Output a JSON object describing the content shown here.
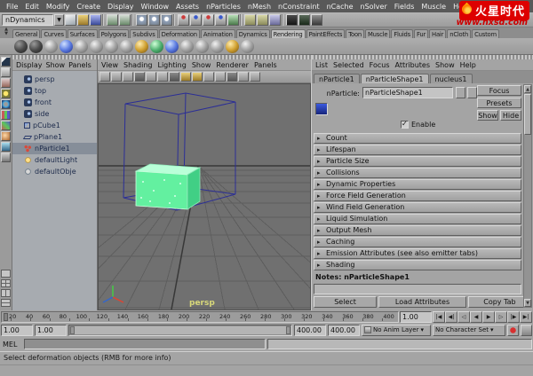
{
  "colors": {
    "viewport_bg": "#707070",
    "particle_green": "#63f0a0",
    "wireframe_blue": "#2b2e96",
    "watermark_red": "#dd0000",
    "selection_highlight": "#868e99"
  },
  "watermark": {
    "brand": "火星时代",
    "url": "www.hxsd.com"
  },
  "menubar": {
    "items": [
      "File",
      "Edit",
      "Modify",
      "Create",
      "Display",
      "Window",
      "Assets",
      "nParticles",
      "nMesh",
      "nConstraint",
      "nCache",
      "nSolver",
      "Fields",
      "Muscle",
      "Help"
    ]
  },
  "statusline": {
    "menuset": "nDynamics",
    "icons": [
      {
        "name": "new-scene-icon",
        "cls": "ic-doc"
      },
      {
        "name": "open-scene-icon",
        "cls": "ic-folder"
      },
      {
        "name": "save-scene-icon",
        "cls": "ic-save"
      },
      {
        "name": "group-separator",
        "cls": "sep"
      },
      {
        "name": "undo-icon",
        "cls": "ic-undo"
      },
      {
        "name": "redo-icon",
        "cls": "ic-redo"
      },
      {
        "name": "group-separator",
        "cls": "sep"
      },
      {
        "name": "select-hierarchy-icon",
        "cls": "ic-sel"
      },
      {
        "name": "select-object-icon",
        "cls": "ic-sel2"
      },
      {
        "name": "select-component-icon",
        "cls": "ic-sel3"
      },
      {
        "name": "group-separator",
        "cls": "sep"
      },
      {
        "name": "snap-to-grid-icon",
        "cls": "ic-snap"
      },
      {
        "name": "snap-to-curve-icon",
        "cls": "ic-snap2"
      },
      {
        "name": "snap-to-point-icon",
        "cls": "ic-snap"
      },
      {
        "name": "snap-to-plane-icon",
        "cls": "ic-snap2"
      },
      {
        "name": "make-live-icon",
        "cls": "ic-live"
      },
      {
        "name": "group-separator",
        "cls": "sep"
      },
      {
        "name": "input-connections-icon",
        "cls": "ic-conn"
      },
      {
        "name": "output-connections-icon",
        "cls": "ic-conn"
      },
      {
        "name": "construction-history-icon",
        "cls": "ic-hist"
      },
      {
        "name": "group-separator",
        "cls": "sep"
      },
      {
        "name": "render-current-frame-icon",
        "cls": "ic-render"
      },
      {
        "name": "ipr-render-icon",
        "cls": "ic-render2"
      },
      {
        "name": "render-settings-icon",
        "cls": "ic-rset"
      }
    ]
  },
  "shelf": {
    "tabs": [
      {
        "label": "General"
      },
      {
        "label": "Curves"
      },
      {
        "label": "Surfaces"
      },
      {
        "label": "Polygons"
      },
      {
        "label": "Subdivs"
      },
      {
        "label": "Deformation"
      },
      {
        "label": "Animation"
      },
      {
        "label": "Dynamics"
      },
      {
        "label": "Rendering",
        "cls": "active"
      },
      {
        "label": "PaintEffects"
      },
      {
        "label": "Toon"
      },
      {
        "label": "Muscle"
      },
      {
        "label": "Fluids"
      },
      {
        "label": "Fur"
      },
      {
        "label": "Hair"
      },
      {
        "label": "nCloth"
      },
      {
        "label": "Custom"
      }
    ],
    "icons": [
      {
        "name": "render-current-icon",
        "cls": "sp-dark"
      },
      {
        "name": "ipr-render-icon",
        "cls": "sp-dark"
      },
      {
        "name": "render-settings-icon",
        "cls": "sp-gray"
      },
      {
        "name": "hypershade-icon",
        "cls": "sp-blue"
      },
      {
        "name": "lambert-material-icon",
        "cls": "sp-gray"
      },
      {
        "name": "blinn-material-icon",
        "cls": "sp-gray"
      },
      {
        "name": "phong-material-icon",
        "cls": "sp-gray"
      },
      {
        "name": "phong-e-material-icon",
        "cls": "sp-gray"
      },
      {
        "name": "anisotropic-material-icon",
        "cls": "sp-yellow"
      },
      {
        "name": "layered-shader-icon",
        "cls": "sp-green"
      },
      {
        "name": "ramp-shader-icon",
        "cls": "sp-blue"
      },
      {
        "name": "shading-map-icon",
        "cls": "sp-gray"
      },
      {
        "name": "surface-shader-icon",
        "cls": "sp-gray"
      },
      {
        "name": "use-background-icon",
        "cls": "sp-gray"
      },
      {
        "name": "env-ball-icon",
        "cls": "sp-yellow"
      },
      {
        "name": "displacement-icon",
        "cls": "sp-gray"
      }
    ]
  },
  "toolbox": {
    "tools": [
      {
        "name": "select-tool-icon",
        "cls": "t-select"
      },
      {
        "name": "lasso-tool-icon",
        "cls": "t-lasso"
      },
      {
        "name": "paint-select-tool-icon",
        "cls": "t-paint"
      },
      {
        "name": "move-tool-icon",
        "cls": "t-move"
      },
      {
        "name": "rotate-tool-icon",
        "cls": "t-rotate"
      },
      {
        "name": "scale-tool-icon",
        "cls": "t-scale"
      },
      {
        "name": "universal-manipulator-icon",
        "cls": "t-universal"
      },
      {
        "name": "soft-modification-icon",
        "cls": "t-softmod"
      },
      {
        "name": "show-manipulator-icon",
        "cls": "t-showmanip"
      },
      {
        "name": "last-tool-icon",
        "cls": "t-lasttool"
      }
    ],
    "layouts": [
      {
        "name": "layout-single-pane-button",
        "cls": "lay1"
      },
      {
        "name": "layout-four-pane-button",
        "cls": "lay4"
      },
      {
        "name": "layout-two-pane-side-button",
        "cls": "lay2"
      },
      {
        "name": "layout-two-pane-stacked-button",
        "cls": "lay2b"
      }
    ]
  },
  "outliner": {
    "menu": [
      "Display",
      "Show",
      "Panels"
    ],
    "items": [
      {
        "label": "persp",
        "icon": "camera"
      },
      {
        "label": "top",
        "icon": "camera"
      },
      {
        "label": "front",
        "icon": "camera"
      },
      {
        "label": "side",
        "icon": "camera"
      },
      {
        "label": "pCube1",
        "icon": "cube"
      },
      {
        "label": "pPlane1",
        "icon": "plane"
      },
      {
        "label": "nParticle1",
        "icon": "particle",
        "cls": "selected"
      },
      {
        "label": "defaultLight",
        "icon": "light"
      },
      {
        "label": "defaultObje",
        "icon": "objset"
      }
    ]
  },
  "viewport": {
    "menu": [
      "View",
      "Shading",
      "Lighting",
      "Show",
      "Renderer",
      "Panels"
    ],
    "camera_label": "persp",
    "toolbar_icons": [
      {
        "name": "grid-toggle-icon",
        "cls": "vg"
      },
      {
        "name": "camera-attributes-icon",
        "cls": "vg"
      },
      {
        "name": "bookmarks-icon",
        "cls": "vg"
      },
      {
        "name": "image-plane-icon",
        "cls": "vd"
      },
      {
        "name": "two-d-pan-zoom-icon",
        "cls": "vg"
      },
      {
        "name": "wireframe-mode-icon",
        "cls": "vg"
      },
      {
        "name": "shaded-mode-icon",
        "cls": "vd"
      },
      {
        "name": "textured-mode-icon",
        "cls": "vy"
      },
      {
        "name": "lighting-mode-icon",
        "cls": "vy"
      },
      {
        "name": "isolate-select-icon",
        "cls": "vg"
      },
      {
        "name": "field-chart-icon",
        "cls": "vg"
      },
      {
        "name": "resolution-gate-icon",
        "cls": "vd"
      },
      {
        "name": "gate-mask-icon",
        "cls": "vg"
      },
      {
        "name": "safe-title-icon",
        "cls": "vg"
      }
    ]
  },
  "attribute_editor": {
    "menu": [
      "List",
      "Selected",
      "Focus",
      "Attributes",
      "Show",
      "Help"
    ],
    "tabs": [
      {
        "label": "nParticle1"
      },
      {
        "label": "nParticleShape1",
        "cls": "active"
      },
      {
        "label": "nucleus1"
      }
    ],
    "node_label": "nParticle:",
    "node_name": "nParticleShape1",
    "focus_button": "Focus",
    "presets_button": "Presets",
    "show_button": "Show",
    "hide_button": "Hide",
    "enable_label": "Enable",
    "enable_checked": true,
    "sections": [
      "Count",
      "Lifespan",
      "Particle Size",
      "Collisions",
      "Dynamic Properties",
      "Force Field Generation",
      "Wind Field Generation",
      "Liquid Simulation",
      "Output Mesh",
      "Caching",
      "Emission Attributes (see also emitter tabs)",
      "Shading"
    ],
    "notes_label": "Notes: nParticleShape1",
    "footer_buttons": [
      "Select",
      "Load Attributes",
      "Copy Tab"
    ]
  },
  "timeline": {
    "ticks": [
      "20",
      "40",
      "60",
      "80",
      "100",
      "120",
      "140",
      "160",
      "180",
      "200",
      "220",
      "240",
      "260",
      "280",
      "300",
      "320",
      "340",
      "360",
      "380",
      "400"
    ],
    "current_time": "1.00",
    "playback": [
      {
        "name": "go-to-playback-start-button",
        "label": "|◀"
      },
      {
        "name": "step-back-frame-button",
        "label": "◀|"
      },
      {
        "name": "step-back-key-button",
        "label": "◁"
      },
      {
        "name": "play-backwards-button",
        "label": "◀"
      },
      {
        "name": "play-forwards-button",
        "label": "▶"
      },
      {
        "name": "step-forward-key-button",
        "label": "▷"
      },
      {
        "name": "step-forward-frame-button",
        "label": "|▶"
      },
      {
        "name": "go-to-playback-end-button",
        "label": "▶|"
      }
    ]
  },
  "range_slider": {
    "animation_start": "1.00",
    "playback_start": "1.00",
    "playback_end": "400.00",
    "animation_end": "400.00",
    "anim_layer": "No Anim Layer",
    "character_set": "No Character Set"
  },
  "command_line": {
    "label": "MEL"
  },
  "help_line": {
    "text": "Select deformation objects (RMB for more info)"
  }
}
